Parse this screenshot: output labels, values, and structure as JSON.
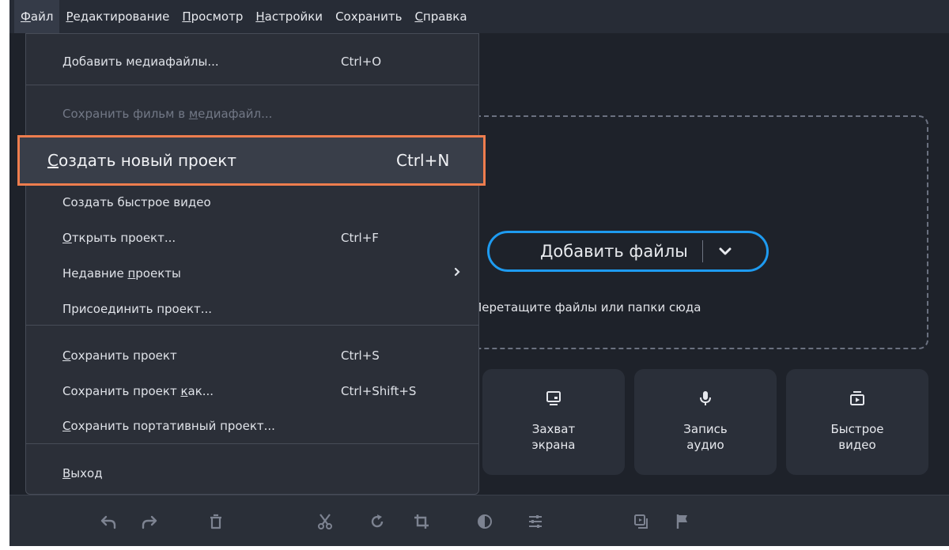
{
  "menubar": [
    {
      "pre": "",
      "acc": "Ф",
      "post": "айл",
      "active": true
    },
    {
      "pre": "",
      "acc": "Р",
      "post": "едактирование",
      "active": false
    },
    {
      "pre": "",
      "acc": "П",
      "post": "росмотр",
      "active": false
    },
    {
      "pre": "",
      "acc": "Н",
      "post": "астройки",
      "active": false
    },
    {
      "pre": "Сохранить",
      "acc": "",
      "post": "",
      "active": false
    },
    {
      "pre": "",
      "acc": "С",
      "post": "правка",
      "active": false
    }
  ],
  "file_menu": {
    "add_media": {
      "label": "Добавить медиафайлы...",
      "shortcut": "Ctrl+O"
    },
    "save_movie": {
      "pre": "Сохранить фильм в ",
      "acc": "м",
      "post": "едиафайл..."
    },
    "new_project": {
      "acc": "С",
      "post": "оздать новый проект",
      "shortcut": "Ctrl+N"
    },
    "quick_video": {
      "label": "Создать быстрое видео"
    },
    "open_project": {
      "acc": "О",
      "post": "ткрыть проект...",
      "shortcut": "Ctrl+F"
    },
    "recent_projects": {
      "pre": "Недавние ",
      "acc": "п",
      "post": "роекты",
      "arrow": "›"
    },
    "join_project": {
      "label": "Присоединить проект..."
    },
    "save_project": {
      "acc": "С",
      "post": "охранить проект",
      "shortcut": "Ctrl+S"
    },
    "save_project_as": {
      "pre": "Сохранить проект ",
      "acc": "к",
      "post": "ак...",
      "shortcut": "Ctrl+Shift+S"
    },
    "save_portable": {
      "acc": "С",
      "post": "охранить портативный проект..."
    },
    "exit": {
      "acc": "В",
      "post": "ыход"
    }
  },
  "dropzone": {
    "add_files": "Добавить файлы",
    "hint": "Перетащите файлы или папки сюда"
  },
  "tiles": [
    {
      "label": "Захват\nэкрана",
      "icon": "monitor-icon"
    },
    {
      "label": "Запись\nаудио",
      "icon": "microphone-icon"
    },
    {
      "label": "Быстрое\nвидео",
      "icon": "quick-video-icon"
    }
  ],
  "toolbar_icons": [
    "undo-icon",
    "redo-icon",
    "delete-icon",
    "cut-icon",
    "rotate-icon",
    "crop-icon",
    "color-adjust-icon",
    "settings-sliders-icon",
    "overlay-icon",
    "marker-flag-icon"
  ],
  "colors": {
    "accent": "#1e9bf0",
    "highlight": "#ee7d4e",
    "menu_bg": "#2b2f38",
    "app_bg": "#1e222a"
  }
}
